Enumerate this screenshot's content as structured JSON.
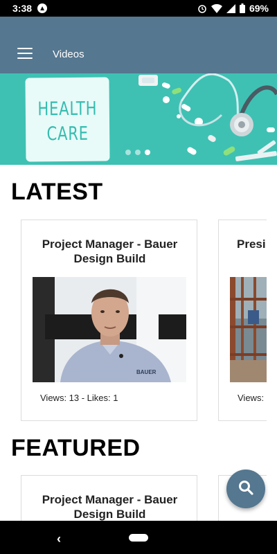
{
  "status_bar": {
    "time": "3:38",
    "battery": "69%",
    "icons": [
      "app-icon",
      "alarm-icon",
      "wifi-icon",
      "signal-icon",
      "battery-icon"
    ]
  },
  "app_bar": {
    "title": "Videos",
    "menu_icon": "hamburger-menu-icon"
  },
  "banner": {
    "line1": "HEALTH",
    "line2": "CARE",
    "slides": 3,
    "active_slide": 3
  },
  "sections": {
    "latest": {
      "title": "LATEST",
      "cards": [
        {
          "title": "Project Manager - Bauer Design Build",
          "meta": "Views: 13 - Likes: 1"
        },
        {
          "title": "Presi",
          "meta": "Views:"
        }
      ]
    },
    "featured": {
      "title": "FEATURED",
      "cards": [
        {
          "title": "Project Manager - Bauer Design Build"
        },
        {
          "title": ""
        }
      ]
    }
  },
  "fab": {
    "icon": "search-icon"
  },
  "nav_bar": {
    "back_icon": "back-icon",
    "home_icon": "home-pill-icon"
  },
  "colors": {
    "app_bar": "#557790",
    "banner": "#3ec1b3",
    "fab": "#557790"
  }
}
